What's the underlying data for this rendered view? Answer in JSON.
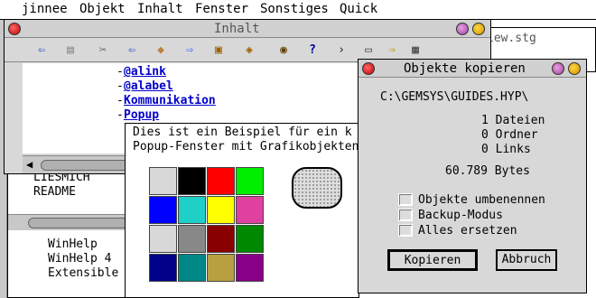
{
  "menubar": {
    "items": [
      "jinnee",
      "Objekt",
      "Inhalt",
      "Fenster",
      "Sonstiges",
      "Quick"
    ]
  },
  "inhalt_window": {
    "title": "Inhalt",
    "links": [
      "@alink",
      "@alabel",
      "Kommunikation",
      "Popup"
    ],
    "toolbar_icons": [
      "back-arrow-icon",
      "document-icon",
      "scissors-icon",
      "back-arrow-icon",
      "diamond-icon",
      "forward-arrow-icon",
      "book-icon",
      "bookmark-icon",
      "eye-icon",
      "help-icon",
      "chevron-icon",
      "disk-icon",
      "arrow-disk-icon",
      "print-icon"
    ]
  },
  "bg_window": {
    "title_fragment": "iew.stg",
    "files": [
      "LIESMICH",
      "README"
    ],
    "lower_files": [
      "WinHelp",
      "WinHelp 4",
      "Extensible"
    ]
  },
  "popup": {
    "text_line1": "Dies ist ein Beispiel für ein k",
    "text_line2": "Popup-Fenster mit Grafikobjekten",
    "colors": [
      "#d8d8d8",
      "#000000",
      "#ff0000",
      "#00ee00",
      "#0000ff",
      "#20d0c8",
      "#ffff00",
      "#e040a0",
      "#d8d8d8",
      "#888888",
      "#880000",
      "#008800",
      "#000088",
      "#008888",
      "#b8a040",
      "#880088"
    ]
  },
  "dialog": {
    "title": "Objekte kopieren",
    "path": "C:\\GEMSYS\\GUIDES.HYP\\",
    "dateien": "1 Dateien",
    "ordner": "0 Ordner",
    "links": "0 Links",
    "bytes": "60.789 Bytes",
    "option1": "Objekte umbenennen",
    "option2": "Backup-Modus",
    "option3": "Alles ersetzen",
    "copy_button": "Kopieren",
    "cancel_button": "Abbruch"
  }
}
